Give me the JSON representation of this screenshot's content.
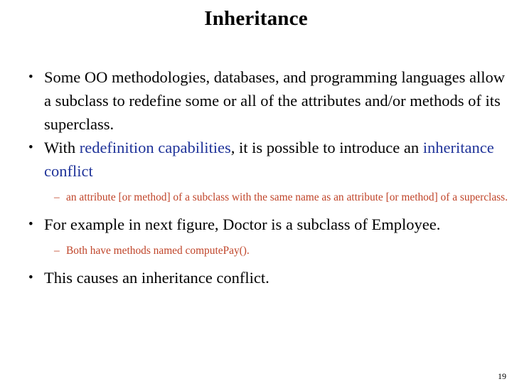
{
  "slide": {
    "title": "Inheritance",
    "page_number": "19",
    "colors": {
      "background": "#FFFFFF",
      "text": "#000000",
      "highlight_blue": "#1F3399",
      "sublevel_red": "#C0452A"
    },
    "bullet_marker_level1": "•",
    "bullet_marker_level2": "–",
    "bullets": {
      "b1_text": "Some OO methodologies, databases, and programming languages allow a subclass to redefine some or all of the attributes and/or methods of its superclass.",
      "b2_lead": "With ",
      "b2_highlight1": "redefinition capabilities",
      "b2_mid": ", it is possible to introduce an ",
      "b2_highlight2": "inheritance conflict",
      "s1_text": "an attribute [or method] of a subclass with the same name as an attribute [or method] of a superclass.",
      "b3_text": "For example in next figure, Doctor is a subclass of Employee.",
      "s2_text": "Both have methods named computePay().",
      "b4_text": "This causes an inheritance conflict."
    }
  }
}
